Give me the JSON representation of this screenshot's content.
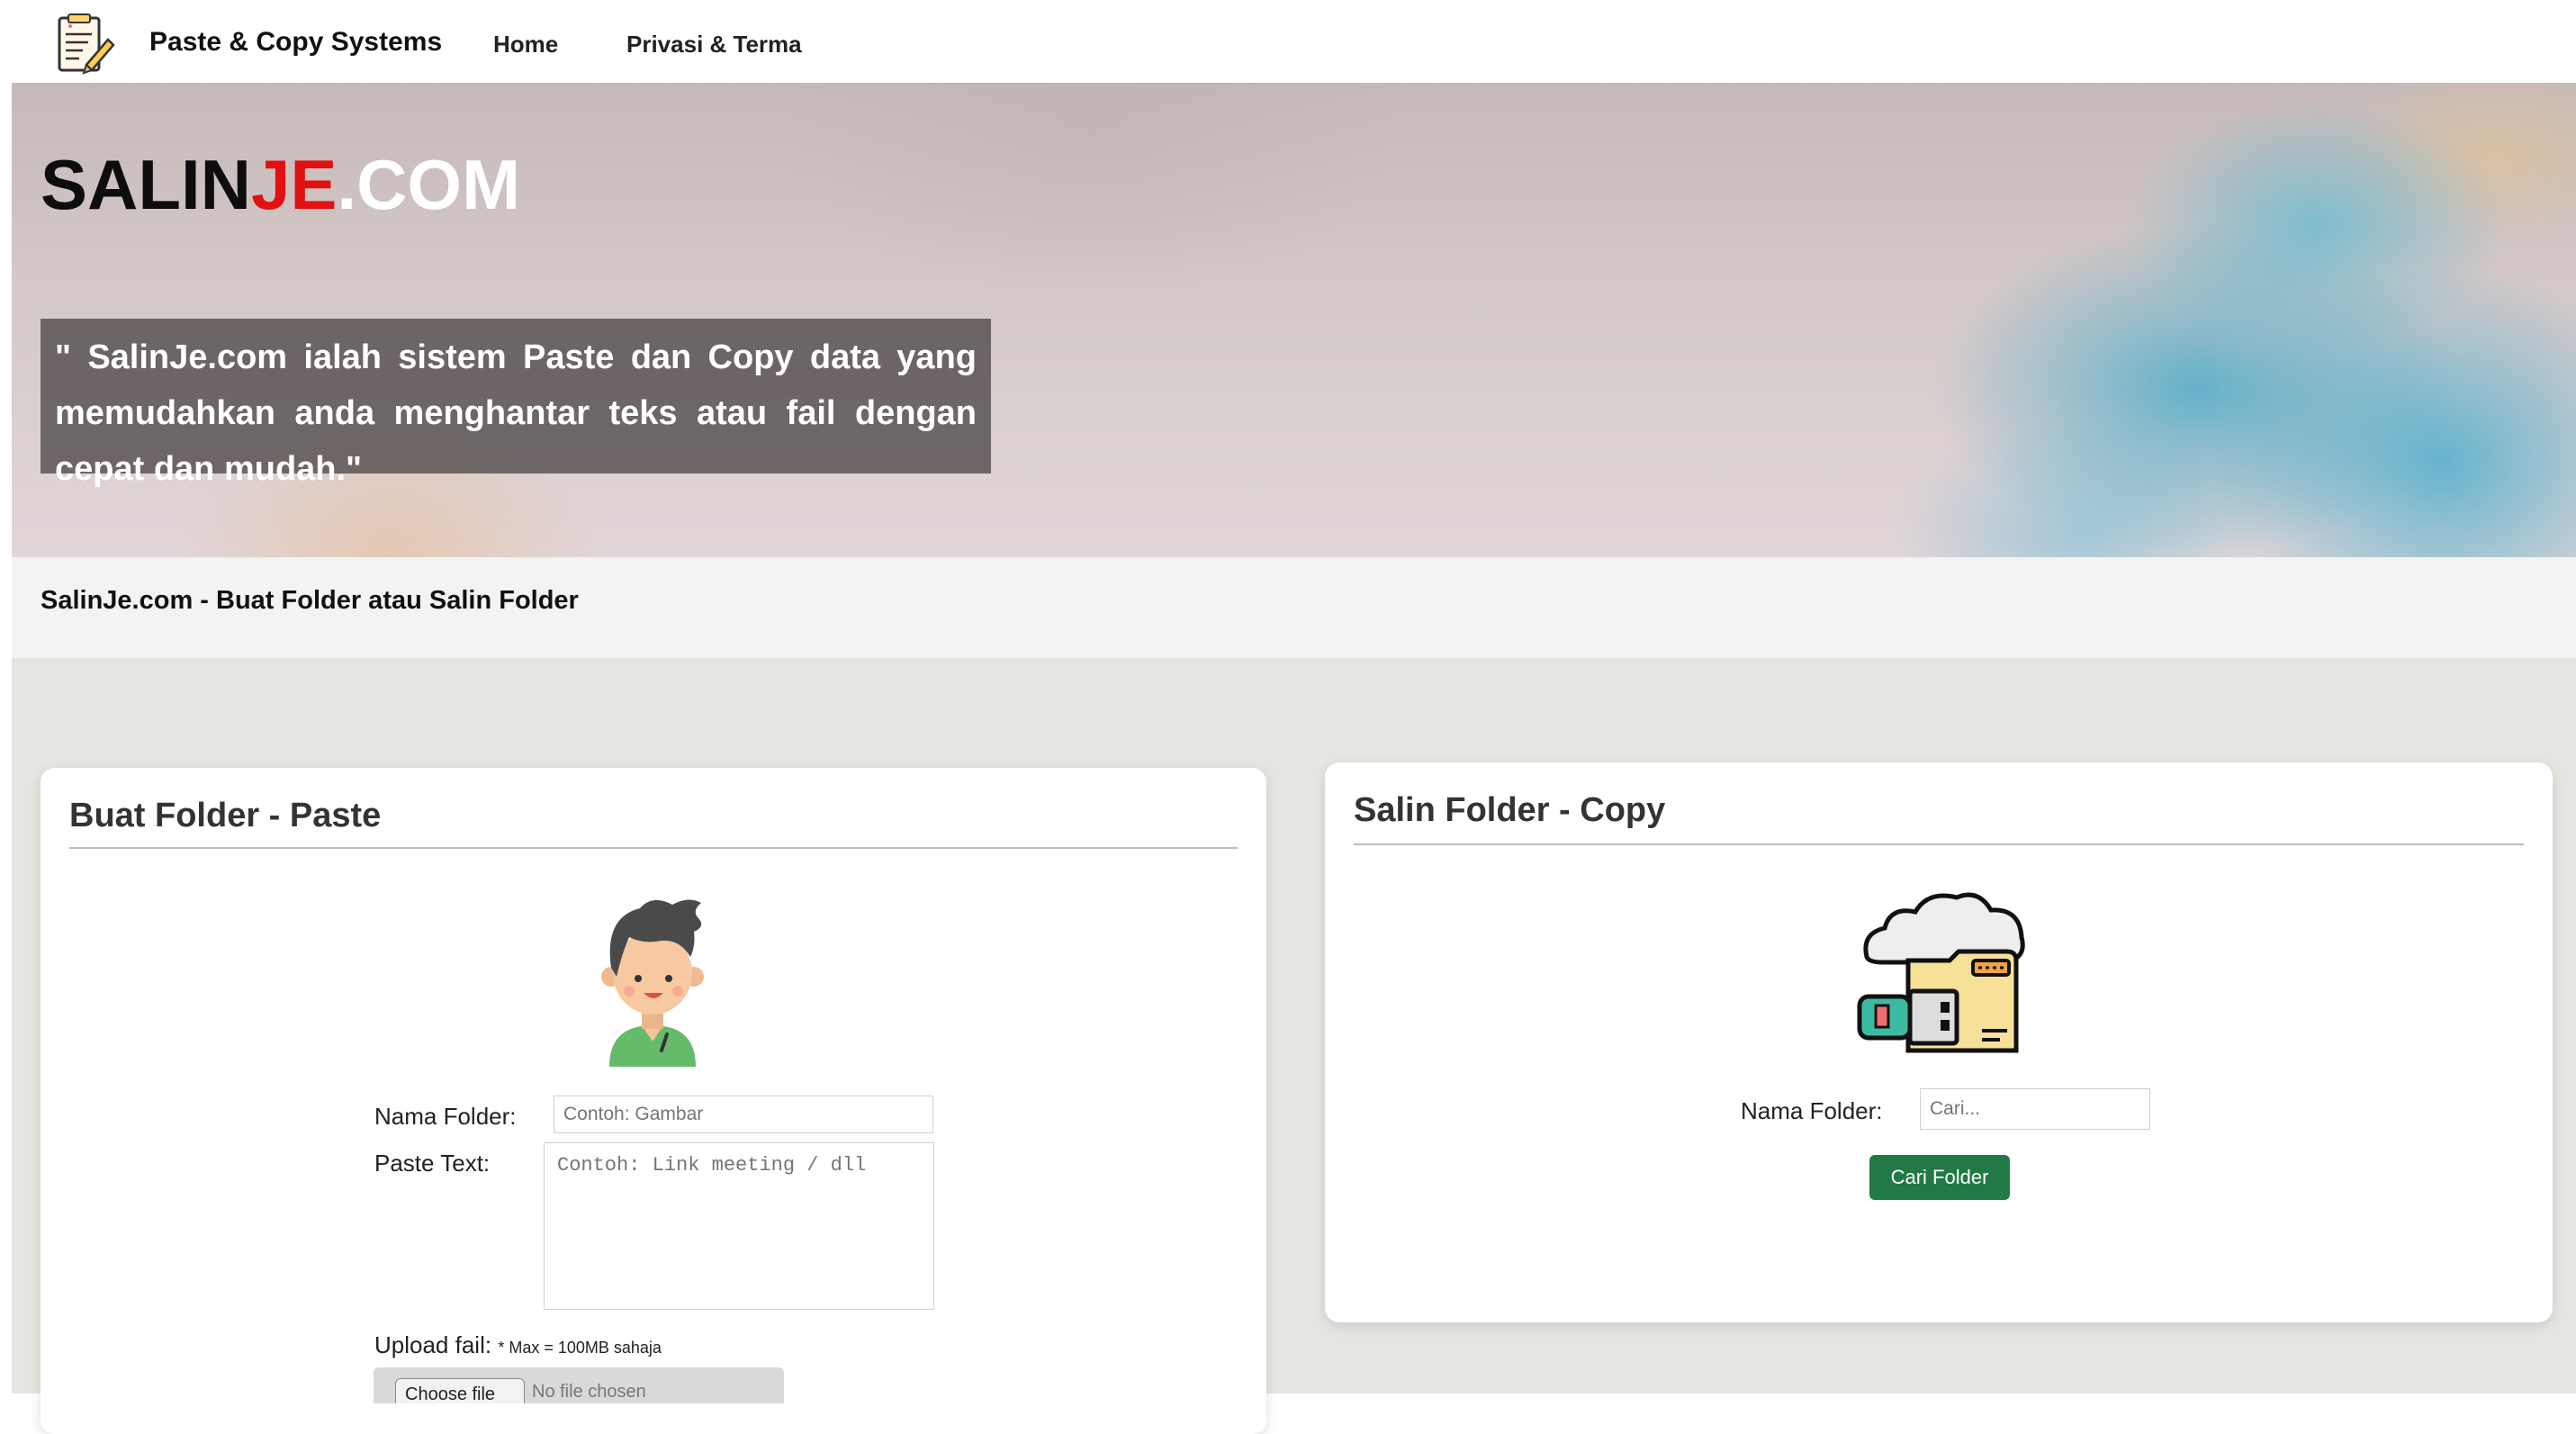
{
  "navbar": {
    "brand": "Paste & Copy Systems",
    "links": [
      "Home",
      "Privasi & Terma"
    ]
  },
  "hero": {
    "title_part1": "SALIN",
    "title_part2": "JE",
    "title_part3": ".COM",
    "quote": "\" SalinJe.com ialah sistem Paste dan Copy data yang memudahkan anda menghantar teks atau fail dengan cepat dan mudah.\""
  },
  "subheader": {
    "text": "SalinJe.com - Buat Folder atau Salin Folder"
  },
  "paste_card": {
    "title": "Buat Folder - Paste",
    "folder_label": "Nama Folder:",
    "folder_placeholder": "Contoh: Gambar",
    "text_label": "Paste Text:",
    "text_placeholder": "Contoh: Link meeting / dll",
    "upload_label": "Upload fail:",
    "upload_note": "* Max = 100MB sahaja",
    "file_button": "Choose file",
    "file_status": "No file chosen"
  },
  "copy_card": {
    "title": "Salin Folder - Copy",
    "folder_label": "Nama Folder:",
    "folder_placeholder": "Cari...",
    "button_label": "Cari Folder"
  },
  "colors": {
    "accent_red": "#e11111",
    "button_green": "#217a45",
    "background_gray": "#e6e6e1"
  }
}
